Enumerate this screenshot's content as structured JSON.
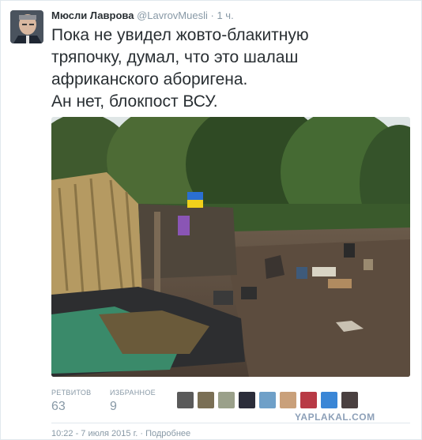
{
  "tweet": {
    "author_name": "Мюсли Лаврова",
    "author_handle": "@LavrovMuesli",
    "separator": "·",
    "time_ago": "1 ч.",
    "text_lines": [
      "Пока не увидел жовто-блакитную",
      "тряпочку, думал, что это шалаш",
      "африканского аборигена.",
      "Ан нет, блокпост ВСУ."
    ]
  },
  "stats": {
    "retweets_label": "РЕТВИТОВ",
    "retweets_value": "63",
    "favorites_label": "ИЗБРАННОЕ",
    "favorites_value": "9"
  },
  "footer": {
    "timestamp": "10:22 - 7 июля 2015 г.",
    "separator": "·",
    "details_link": "Подробнее"
  },
  "watermark": "YAPLAKAL.COM",
  "colors": {
    "text": "#292f33",
    "muted": "#8899a6",
    "border": "#e1e8ed",
    "flag_blue": "#2a6fd1",
    "flag_yellow": "#f2d11b"
  }
}
